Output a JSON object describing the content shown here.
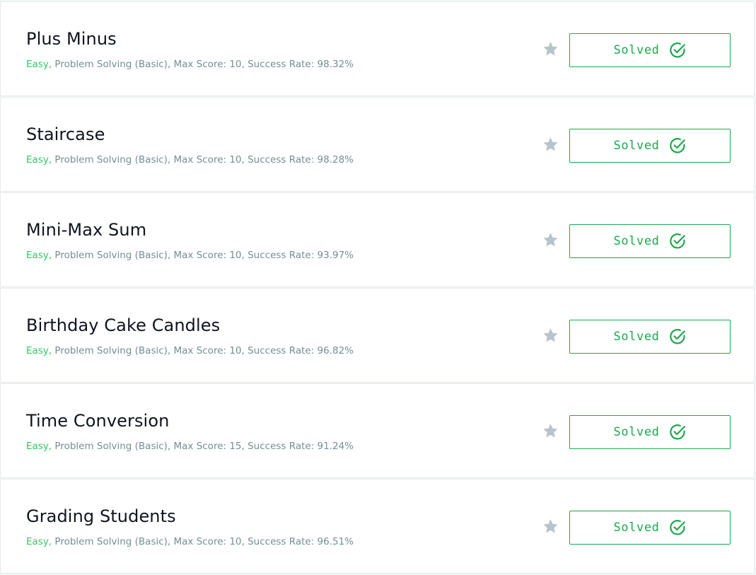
{
  "challenges": [
    {
      "title": "Plus Minus",
      "difficulty": "Easy,",
      "details": " Problem Solving (Basic), Max Score: 10, Success Rate: 98.32%",
      "status_label": "Solved",
      "star_icon": "star-icon",
      "status_icon": "check-circle-icon"
    },
    {
      "title": "Staircase",
      "difficulty": "Easy,",
      "details": " Problem Solving (Basic), Max Score: 10, Success Rate: 98.28%",
      "status_label": "Solved",
      "star_icon": "star-icon",
      "status_icon": "check-circle-icon"
    },
    {
      "title": "Mini-Max Sum",
      "difficulty": "Easy,",
      "details": " Problem Solving (Basic), Max Score: 10, Success Rate: 93.97%",
      "status_label": "Solved",
      "star_icon": "star-icon",
      "status_icon": "check-circle-icon"
    },
    {
      "title": "Birthday Cake Candles",
      "difficulty": "Easy,",
      "details": " Problem Solving (Basic), Max Score: 10, Success Rate: 96.82%",
      "status_label": "Solved",
      "star_icon": "star-icon",
      "status_icon": "check-circle-icon"
    },
    {
      "title": "Time Conversion",
      "difficulty": "Easy,",
      "details": " Problem Solving (Basic), Max Score: 15, Success Rate: 91.24%",
      "status_label": "Solved",
      "star_icon": "star-icon",
      "status_icon": "check-circle-icon"
    },
    {
      "title": "Grading Students",
      "difficulty": "Easy,",
      "details": " Problem Solving (Basic), Max Score: 10, Success Rate: 96.51%",
      "status_label": "Solved",
      "star_icon": "star-icon",
      "status_icon": "check-circle-icon"
    }
  ],
  "colors": {
    "accent_green": "#1ba94c",
    "difficulty_easy": "#2ec866",
    "meta_text": "#738f93",
    "star": "#b7c5ca",
    "title_text": "#0e141e",
    "card_background": "#ffffff",
    "card_border": "#e6eaed"
  }
}
